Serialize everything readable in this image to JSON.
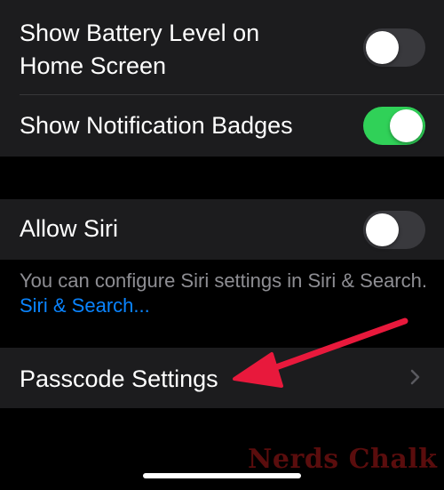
{
  "settings": {
    "battery_level_label": "Show Battery Level on Home Screen",
    "battery_level_line1": "Show Battery Level on",
    "battery_level_line2": "Home Screen",
    "battery_level_on": false,
    "notification_badges_label": "Show Notification Badges",
    "notification_badges_on": true,
    "allow_siri_label": "Allow Siri",
    "allow_siri_on": false,
    "siri_footnote_text": "You can configure Siri settings in Siri & Search.",
    "siri_footnote_link": "Siri & Search...",
    "passcode_settings_label": "Passcode Settings"
  },
  "colors": {
    "background": "#000000",
    "cell_background": "#1c1c1e",
    "toggle_on": "#30d158",
    "toggle_off": "#39393d",
    "link": "#0a84ff",
    "annotation_arrow": "#e8193c"
  },
  "icons": {
    "row_chevron": "chevron-right-icon",
    "annotation": "red-arrow-annotation"
  },
  "watermark": {
    "text": "Nerds Chalk"
  }
}
